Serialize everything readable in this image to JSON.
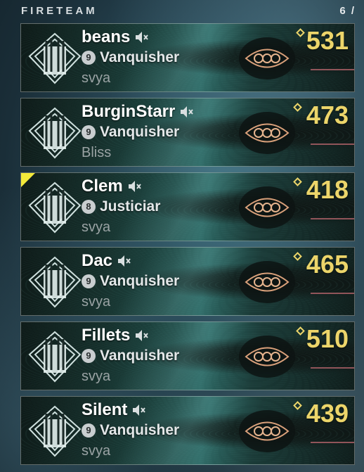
{
  "header": {
    "title": "FIRETEAM",
    "count": "6 /"
  },
  "members": [
    {
      "name": "beans",
      "rank_number": "9",
      "rank_title": "Vanquisher",
      "clan": "svya",
      "power": "531",
      "selected": false
    },
    {
      "name": "BurginStarr",
      "rank_number": "9",
      "rank_title": "Vanquisher",
      "clan": "Bliss",
      "power": "473",
      "selected": false
    },
    {
      "name": "Clem",
      "rank_number": "8",
      "rank_title": "Justiciar",
      "clan": "svya",
      "power": "418",
      "selected": true
    },
    {
      "name": "Dac",
      "rank_number": "9",
      "rank_title": "Vanquisher",
      "clan": "svya",
      "power": "465",
      "selected": false
    },
    {
      "name": "Fillets",
      "rank_number": "9",
      "rank_title": "Vanquisher",
      "clan": "svya",
      "power": "510",
      "selected": false
    },
    {
      "name": "Silent",
      "rank_number": "9",
      "rank_title": "Vanquisher",
      "clan": "svya",
      "power": "439",
      "selected": false
    }
  ],
  "icons": {
    "emblem": "emblem-icon",
    "mute": "mute-icon",
    "power": "power-icon",
    "ghost": "ghost-mark-icon"
  },
  "colors": {
    "accent_yellow": "#f3e93a",
    "power_gold": "#ecd56a"
  }
}
